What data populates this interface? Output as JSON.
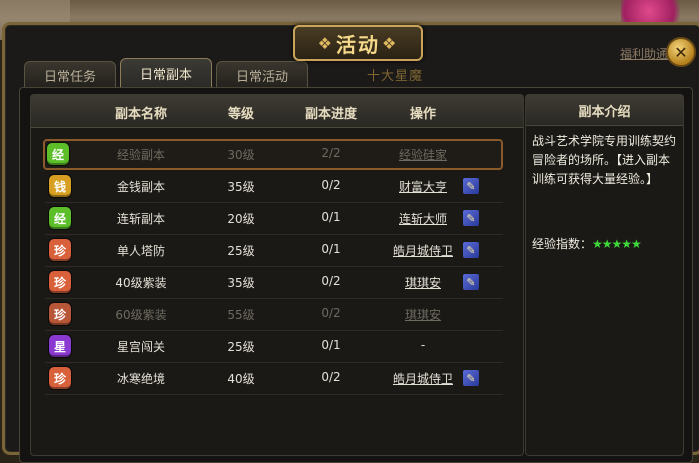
{
  "window": {
    "title": "活动",
    "title_ornament": "❖",
    "close_glyph": "✕",
    "welfare_link": "福利助通",
    "banner": "十大星魔"
  },
  "tabs": [
    {
      "label": "日常任务",
      "active": false
    },
    {
      "label": "日常副本",
      "active": true
    },
    {
      "label": "日常活动",
      "active": false
    }
  ],
  "table": {
    "headers": {
      "name": "副本名称",
      "level": "等级",
      "progress": "副本进度",
      "action": "操作"
    },
    "rows": [
      {
        "badge": "经",
        "badge_color": "#5cbf2a",
        "name": "经验副本",
        "level": "30级",
        "progress": "2/2",
        "action": "经验硅家",
        "dim": true,
        "selected": true,
        "quill": false
      },
      {
        "badge": "钱",
        "badge_color": "#d8a023",
        "name": "金钱副本",
        "level": "35级",
        "progress": "0/2",
        "action": "财富大亨",
        "dim": false,
        "selected": false,
        "quill": true
      },
      {
        "badge": "经",
        "badge_color": "#5cbf2a",
        "name": "连斩副本",
        "level": "20级",
        "progress": "0/1",
        "action": "连斩大师",
        "dim": false,
        "selected": false,
        "quill": true
      },
      {
        "badge": "珍",
        "badge_color": "#d8603a",
        "name": "单人塔防",
        "level": "25级",
        "progress": "0/1",
        "action": "皓月城侍卫",
        "dim": false,
        "selected": false,
        "quill": true
      },
      {
        "badge": "珍",
        "badge_color": "#d8603a",
        "name": "40级紫装",
        "level": "35级",
        "progress": "0/2",
        "action": "琪琪安",
        "dim": false,
        "selected": false,
        "quill": true
      },
      {
        "badge": "珍",
        "badge_color": "#b85638",
        "name": "60级紫装",
        "level": "55级",
        "progress": "0/2",
        "action": "琪琪安",
        "dim": true,
        "selected": false,
        "quill": false
      },
      {
        "badge": "星",
        "badge_color": "#8a3ad0",
        "name": "星宫闯关",
        "level": "25级",
        "progress": "0/1",
        "action": "-",
        "dim": false,
        "selected": false,
        "quill": false
      },
      {
        "badge": "珍",
        "badge_color": "#d8603a",
        "name": "冰寒绝境",
        "level": "40级",
        "progress": "0/2",
        "action": "皓月城侍卫",
        "dim": false,
        "selected": false,
        "quill": true
      }
    ],
    "quill_glyph": "✎"
  },
  "info": {
    "header": "副本介绍",
    "description": "战斗艺术学院专用训练契约冒险者的场所。【进入副本训练可获得大量经验。】",
    "rating_label": "经验指数：",
    "rating_stars": "★★★★★"
  }
}
